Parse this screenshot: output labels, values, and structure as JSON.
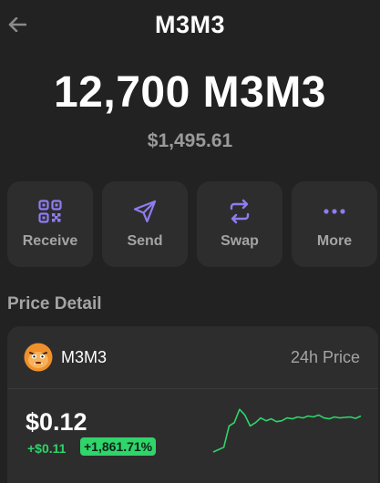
{
  "header": {
    "title": "M3M3",
    "back_icon": "arrow-left-icon"
  },
  "balance": {
    "amount": "12,700 M3M3",
    "fiat": "$1,495.61"
  },
  "actions": [
    {
      "label": "Receive",
      "icon": "qr-code-icon"
    },
    {
      "label": "Send",
      "icon": "send-icon"
    },
    {
      "label": "Swap",
      "icon": "swap-icon"
    },
    {
      "label": "More",
      "icon": "more-dots-icon"
    }
  ],
  "price_detail": {
    "section_title": "Price Detail",
    "token_name": "M3M3",
    "token_logo_icon": "token-logo-icon",
    "period_label": "24h Price",
    "price": "$0.12",
    "change_abs": "+$0.11",
    "change_pct": "+1,861.71%",
    "sparkline": [
      0.0,
      0.05,
      0.1,
      0.55,
      0.62,
      0.9,
      0.78,
      0.55,
      0.62,
      0.72,
      0.66,
      0.7,
      0.64,
      0.66,
      0.72,
      0.7,
      0.74,
      0.72,
      0.76,
      0.74,
      0.78,
      0.72,
      0.7,
      0.74,
      0.72,
      0.73,
      0.74,
      0.71,
      0.76
    ]
  },
  "colors": {
    "accent": "#8f7cf0",
    "positive": "#2fd46a",
    "muted": "#a4a4a4",
    "card": "#2d2d2d",
    "background": "#222222"
  }
}
